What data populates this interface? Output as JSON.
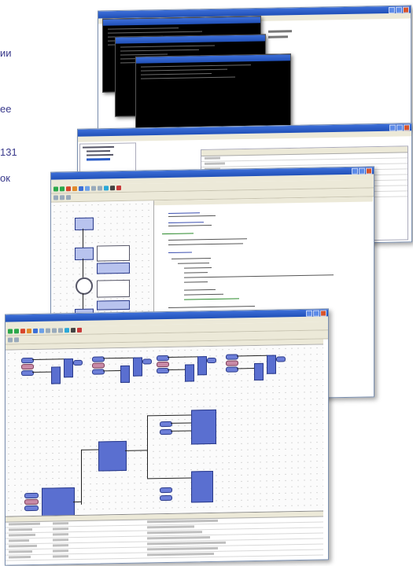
{
  "side_text": {
    "line1": "ии",
    "line2": "ее",
    "line3": "131",
    "line4": "ок"
  },
  "colors": {
    "titlebar": "#2a5cc8",
    "fbd_block": "#5a6fd0",
    "fbd_block_light": "#b8c3ee",
    "pin_pink": "#c98aa6",
    "console": "#000000"
  },
  "icons": [
    "window-minimize-icon",
    "window-maximize-icon",
    "window-close-icon",
    "toolbar-icon"
  ]
}
